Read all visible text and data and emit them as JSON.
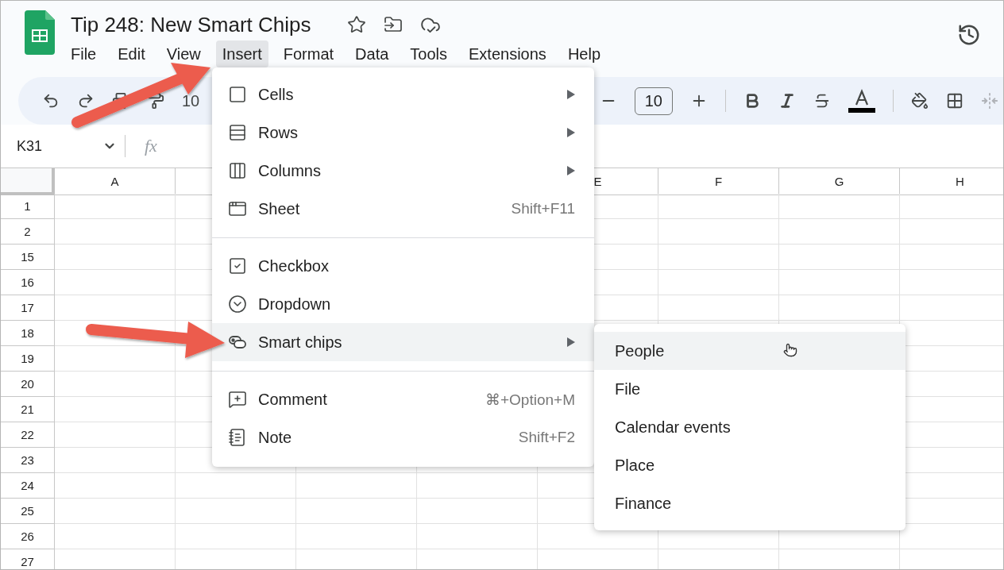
{
  "document": {
    "title": "Tip 248: New Smart Chips"
  },
  "menubar": [
    {
      "label": "File",
      "selected": false
    },
    {
      "label": "Edit",
      "selected": false
    },
    {
      "label": "View",
      "selected": false
    },
    {
      "label": "Insert",
      "selected": true
    },
    {
      "label": "Format",
      "selected": false
    },
    {
      "label": "Data",
      "selected": false
    },
    {
      "label": "Tools",
      "selected": false
    },
    {
      "label": "Extensions",
      "selected": false
    },
    {
      "label": "Help",
      "selected": false
    }
  ],
  "toolbar": {
    "zoom": "10",
    "font_size": "10"
  },
  "formula_bar": {
    "cell_reference": "K31",
    "function_label": "fx"
  },
  "sheet": {
    "columns": [
      {
        "label": "A"
      },
      {},
      {},
      {},
      {
        "label": "E"
      },
      {
        "label": "F"
      },
      {
        "label": "G"
      },
      {
        "label": "H"
      }
    ],
    "rows": [
      "1",
      "2",
      "15",
      "16",
      "17",
      "18",
      "19",
      "20",
      "21",
      "22",
      "23",
      "24",
      "25",
      "26",
      "27"
    ]
  },
  "insert_menu": {
    "sections": [
      [
        {
          "label": "Cells",
          "has_submenu": true,
          "selected": false
        },
        {
          "label": "Rows",
          "has_submenu": true,
          "selected": false
        },
        {
          "label": "Columns",
          "has_submenu": true,
          "selected": false
        },
        {
          "label": "Sheet",
          "shortcut": "Shift+F11",
          "has_submenu": false,
          "selected": false
        }
      ],
      [
        {
          "label": "Checkbox",
          "has_submenu": false,
          "selected": false
        },
        {
          "label": "Dropdown",
          "has_submenu": false,
          "selected": false
        },
        {
          "label": "Smart chips",
          "has_submenu": true,
          "selected": true
        }
      ],
      [
        {
          "label": "Comment",
          "shortcut": "⌘+Option+M",
          "has_submenu": false,
          "selected": false
        },
        {
          "label": "Note",
          "shortcut": "Shift+F2",
          "has_submenu": false,
          "selected": false
        }
      ]
    ]
  },
  "smart_chips_submenu": {
    "items": [
      {
        "label": "People",
        "selected": true
      },
      {
        "label": "File",
        "selected": false
      },
      {
        "label": "Calendar events",
        "selected": false
      },
      {
        "label": "Place",
        "selected": false
      },
      {
        "label": "Finance",
        "selected": false
      }
    ]
  }
}
